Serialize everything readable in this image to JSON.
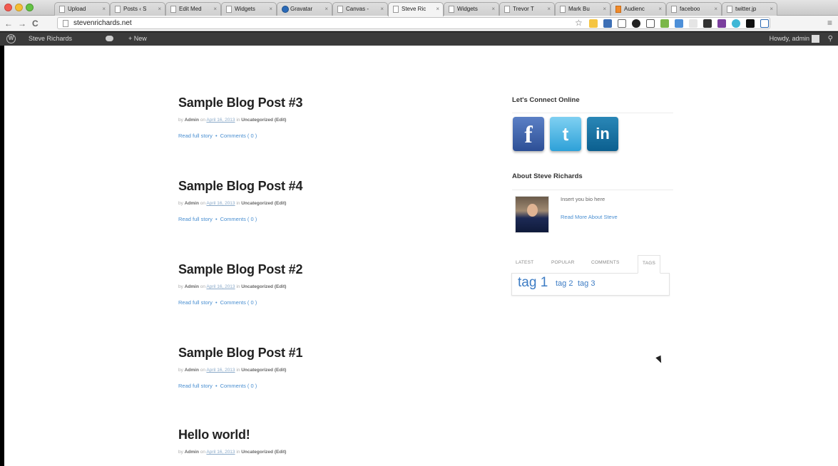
{
  "browser": {
    "tabs": [
      {
        "label": "Upload",
        "icon": "doc-icon"
      },
      {
        "label": "Posts ‹ S",
        "icon": "doc-icon"
      },
      {
        "label": "Edit Med",
        "icon": "doc-icon"
      },
      {
        "label": "Widgets",
        "icon": "doc-icon"
      },
      {
        "label": "Gravatar",
        "icon": "gravatar-icon"
      },
      {
        "label": "Canvas -",
        "icon": "doc-icon"
      },
      {
        "label": "Steve Ric",
        "icon": "doc-icon",
        "active": true
      },
      {
        "label": "Widgets",
        "icon": "doc-icon"
      },
      {
        "label": "Trevor T",
        "icon": "doc-icon"
      },
      {
        "label": "Mark Bu",
        "icon": "doc-icon"
      },
      {
        "label": "Audienc",
        "icon": "audience-icon"
      },
      {
        "label": "faceboo",
        "icon": "doc-icon"
      },
      {
        "label": "twitter.jp",
        "icon": "doc-icon"
      }
    ],
    "tab_close": "×",
    "back": "←",
    "forward": "→",
    "reload": "C",
    "url": "stevenrichards.net",
    "bookmark_star": "☆",
    "menu": "≡"
  },
  "adminbar": {
    "wp_logo": "W",
    "site_name": "Steve Richards",
    "new_label": "+ New",
    "howdy": "Howdy, admin",
    "search": "⚲"
  },
  "posts": [
    {
      "title": "Sample Blog Post #3",
      "by": "by",
      "author": "Admin",
      "on": "on",
      "date": "April 16, 2013",
      "in": "in",
      "category": "Uncategorized",
      "edit": "(Edit)",
      "read_more": "Read full story",
      "comments": "Comments ( 0 )"
    },
    {
      "title": "Sample Blog Post #4",
      "by": "by",
      "author": "Admin",
      "on": "on",
      "date": "April 16, 2013",
      "in": "in",
      "category": "Uncategorized",
      "edit": "(Edit)",
      "read_more": "Read full story",
      "comments": "Comments ( 0 )"
    },
    {
      "title": "Sample Blog Post #2",
      "by": "by",
      "author": "Admin",
      "on": "on",
      "date": "April 16, 2013",
      "in": "in",
      "category": "Uncategorized",
      "edit": "(Edit)",
      "read_more": "Read full story",
      "comments": "Comments ( 0 )"
    },
    {
      "title": "Sample Blog Post #1",
      "by": "by",
      "author": "Admin",
      "on": "on",
      "date": "April 16, 2013",
      "in": "in",
      "category": "Uncategorized",
      "edit": "(Edit)",
      "read_more": "Read full story",
      "comments": "Comments ( 0 )"
    },
    {
      "title": "Hello world!",
      "by": "by",
      "author": "Admin",
      "on": "on",
      "date": "April 16, 2013",
      "in": "in",
      "category": "Uncategorized",
      "edit": "(Edit)"
    }
  ],
  "sidebar": {
    "connect_title": "Let's Connect Online",
    "social": {
      "facebook": "f",
      "twitter": "t",
      "linkedin": "in"
    },
    "about_title": "About Steve Richards",
    "bio_text": "Insert you bio here",
    "bio_link": "Read More About Steve",
    "tabs": [
      "LATEST",
      "POPULAR",
      "COMMENTS",
      "TAGS"
    ],
    "active_tab": "TAGS",
    "tags": [
      "tag 1",
      "tag 2",
      "tag 3"
    ]
  },
  "colors": {
    "link": "#4a8fd1",
    "admin_bar": "#3a3a3a",
    "facebook": "#3b5998",
    "twitter": "#33a9e0",
    "linkedin": "#0b6fa0"
  }
}
